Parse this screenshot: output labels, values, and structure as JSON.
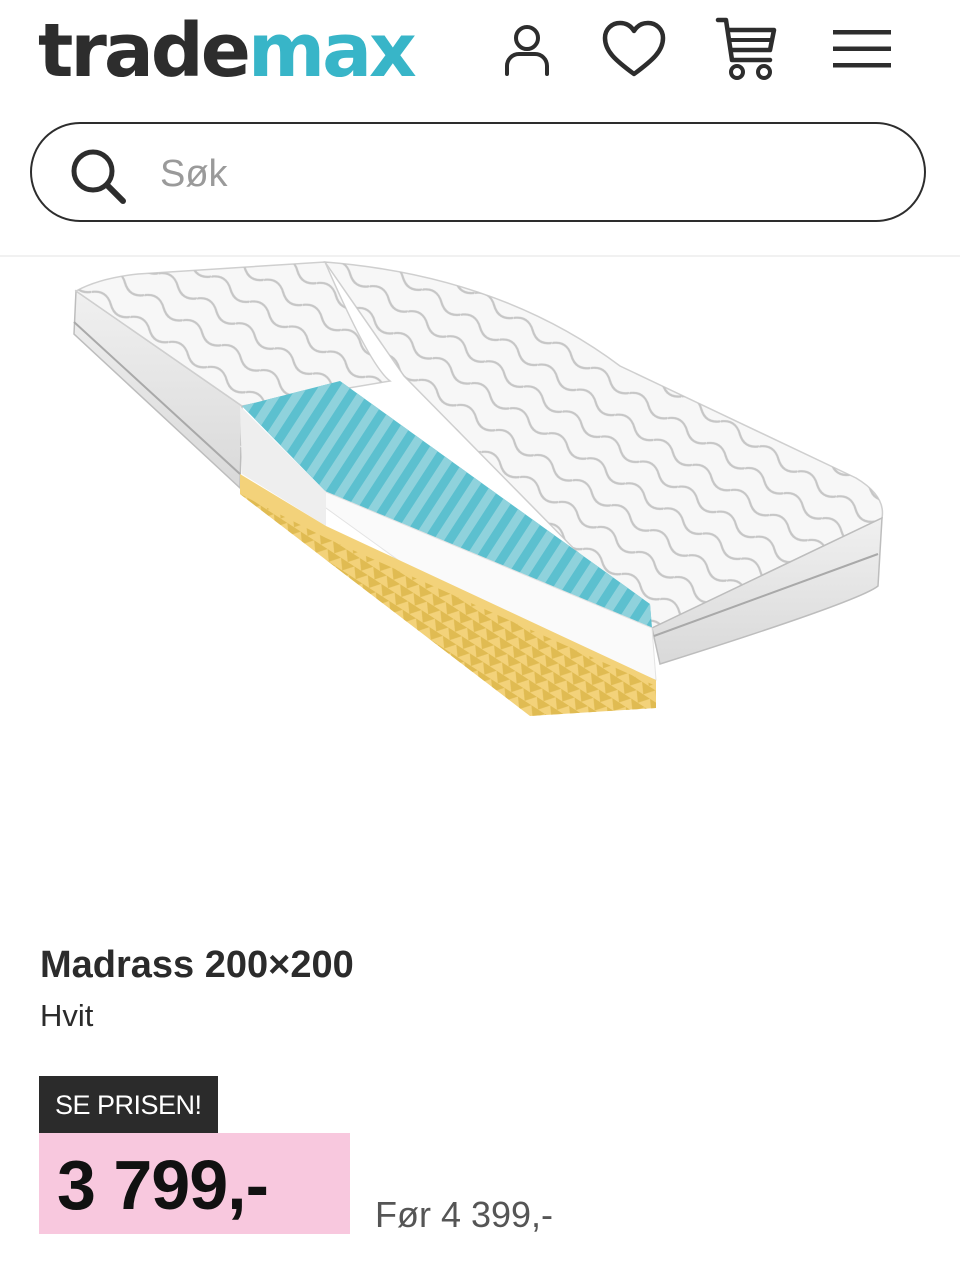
{
  "header": {
    "logo_part1": "trade",
    "logo_part2": "max",
    "brand_color": "#38b5c8",
    "icons": [
      "user-icon",
      "heart-icon",
      "cart-icon",
      "menu-icon"
    ]
  },
  "search": {
    "placeholder": "Søk",
    "value": ""
  },
  "product": {
    "title": "Madrass 200×200",
    "color": "Hvit",
    "badge": "SE PRISEN!",
    "price": "3 799,-",
    "price_before": "Før 4 399,-",
    "badge_color": "#2b2b2b",
    "price_bg_color": "#f8c8de"
  }
}
